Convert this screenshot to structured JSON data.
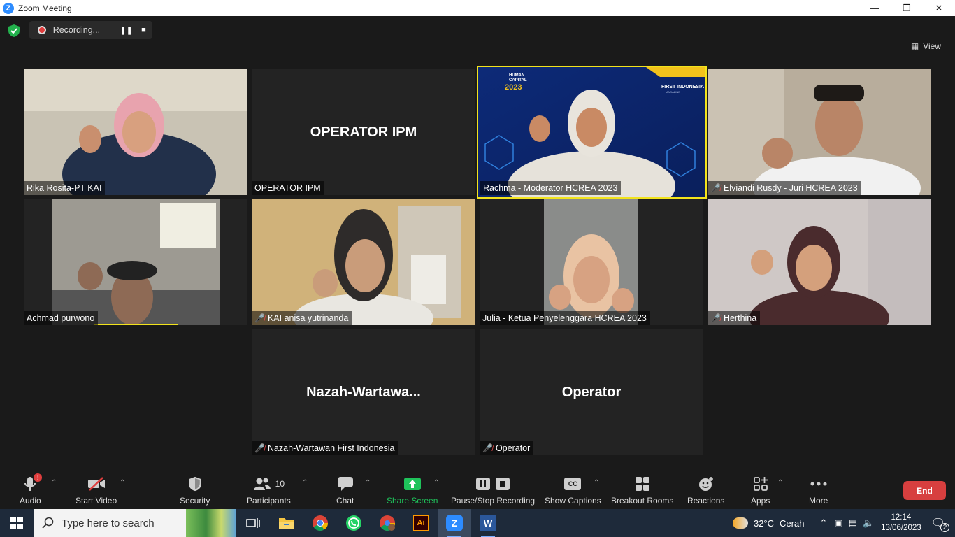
{
  "window": {
    "title": "Zoom Meeting"
  },
  "topbar": {
    "recording_label": "Recording...",
    "view_label": "View"
  },
  "tiles": [
    {
      "name": "Rika Rosita-PT KAI",
      "muted": false,
      "video": true
    },
    {
      "name": "OPERATOR IPM",
      "display": "OPERATOR IPM",
      "muted": false,
      "video": false
    },
    {
      "name": "Rachma - Moderator HCREA 2023",
      "muted": false,
      "video": true,
      "active_speaker": true
    },
    {
      "name": "Elviandi Rusdy - Juri HCREA 2023",
      "muted": true,
      "video": true
    },
    {
      "name": "Achmad purwono",
      "muted": false,
      "video": true
    },
    {
      "name": "KAI anisa yutrinanda",
      "muted": true,
      "video": true
    },
    {
      "name": "Julia - Ketua Penyelenggara HCREA 2023",
      "muted": false,
      "video": true
    },
    {
      "name": "Herthina",
      "muted": true,
      "video": true
    },
    {
      "name": "Nazah-Wartawan First Indonesia",
      "display": "Nazah-Wartawa...",
      "muted": true,
      "video": false
    },
    {
      "name": "Operator",
      "display": "Operator",
      "muted": true,
      "video": false
    }
  ],
  "background_text": {
    "hc_line1": "HUMAN",
    "hc_line2": "CAPITAL",
    "hc_year": "2023",
    "fi_line1": "FIRST INDONESIA",
    "fi_line2": "MAGAZINE"
  },
  "toolbar": {
    "audio": "Audio",
    "audio_badge": "!",
    "start_video": "Start Video",
    "security": "Security",
    "participants": "Participants",
    "participants_count": "10",
    "chat": "Chat",
    "share_screen": "Share Screen",
    "pause_stop_recording": "Pause/Stop Recording",
    "show_captions": "Show Captions",
    "cc_icon_text": "CC",
    "breakout_rooms": "Breakout Rooms",
    "reactions": "Reactions",
    "apps": "Apps",
    "more": "More",
    "end": "End"
  },
  "taskbar": {
    "search_placeholder": "Type here to search",
    "weather_temp": "32°C",
    "weather_desc": "Cerah",
    "time": "12:14",
    "date": "13/06/2023",
    "notifications": "2",
    "illustrator_label": "Ai"
  },
  "colors": {
    "accent_blue": "#2d8cff",
    "active_speaker": "#f2e31c",
    "end_red": "#d73f3f",
    "share_green": "#1fc35b",
    "mute_red": "#e04a4a"
  }
}
